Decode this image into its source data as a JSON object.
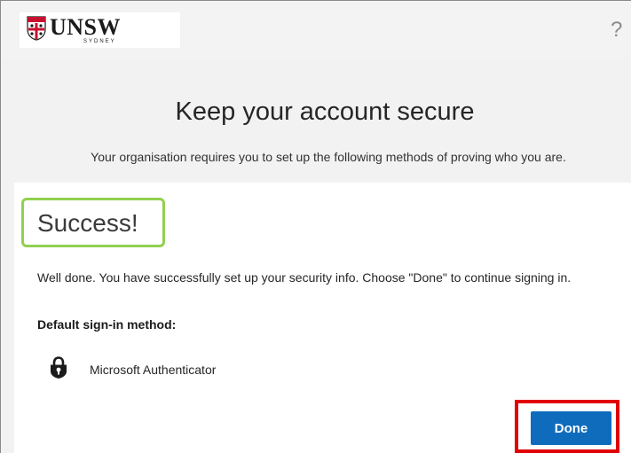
{
  "header": {
    "logo": {
      "main": "UNSW",
      "sub": "SYDNEY",
      "crest": "unsw-crest-icon"
    },
    "help": {
      "label": "?",
      "icon": "help-icon"
    }
  },
  "page": {
    "title": "Keep your account secure",
    "subtitle": "Your organisation requires you to set up the following methods of proving who you are."
  },
  "card": {
    "status": "Success!",
    "message": "Well done. You have successfully set up your security info. Choose \"Done\" to continue signing in.",
    "method_heading": "Default sign-in method:",
    "method": {
      "name": "Microsoft Authenticator",
      "icon": "authenticator-lock-icon"
    },
    "done_label": "Done"
  },
  "colors": {
    "accent": "#0f6cbd",
    "success_outline": "#92d050",
    "done_highlight": "#e00000"
  }
}
